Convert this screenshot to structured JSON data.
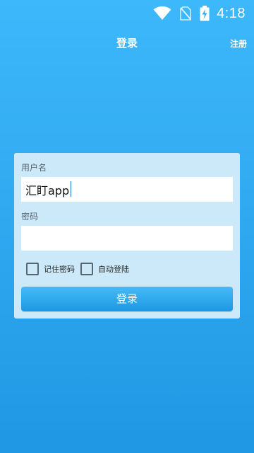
{
  "status_bar": {
    "time": "4:18",
    "icons": [
      "wifi-icon",
      "no-sim-icon",
      "battery-charging-icon"
    ]
  },
  "header": {
    "title": "登录",
    "register_label": "注册"
  },
  "login_form": {
    "username_label": "用户名",
    "username_value": "汇盯app",
    "password_label": "密码",
    "password_value": "",
    "remember_password_label": "记住密码",
    "remember_password_checked": false,
    "auto_login_label": "自动登陆",
    "auto_login_checked": false,
    "login_button_label": "登录"
  },
  "colors": {
    "background_top": "#3db8fb",
    "background_bottom": "#1f97e2",
    "card": "#cce9fa",
    "button": "#2aa6ee"
  }
}
